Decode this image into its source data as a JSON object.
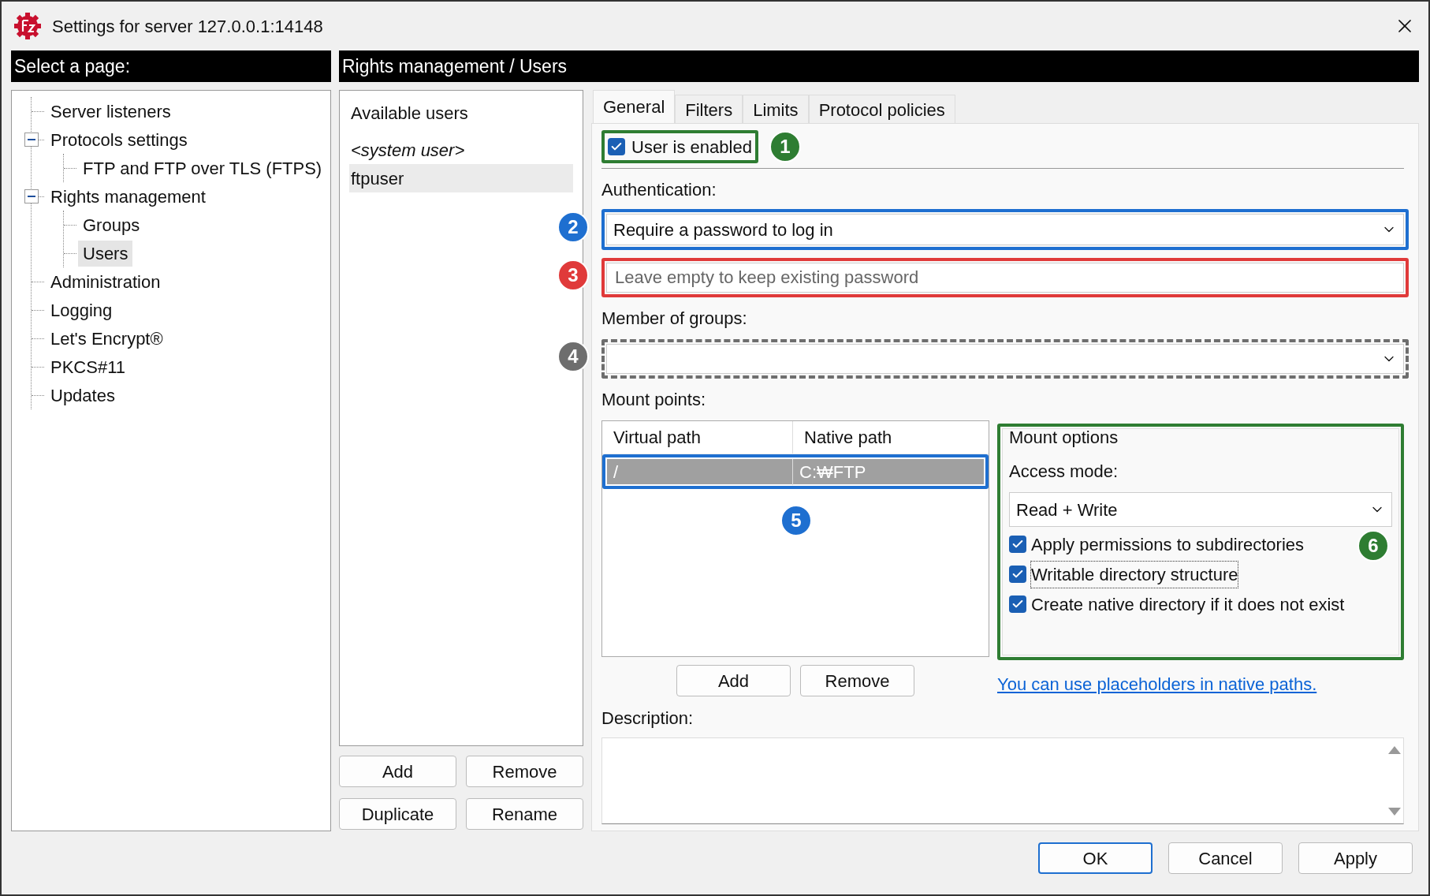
{
  "window": {
    "title": "Settings for server 127.0.0.1:14148"
  },
  "page_selector": {
    "heading": "Select a page:",
    "tree": [
      {
        "label": "Server listeners",
        "selected": false
      },
      {
        "label": "Protocols settings",
        "selected": false,
        "expanded": true,
        "children": [
          {
            "label": "FTP and FTP over TLS (FTPS)",
            "selected": false
          }
        ]
      },
      {
        "label": "Rights management",
        "selected": false,
        "expanded": true,
        "children": [
          {
            "label": "Groups",
            "selected": false
          },
          {
            "label": "Users",
            "selected": true
          }
        ]
      },
      {
        "label": "Administration",
        "selected": false
      },
      {
        "label": "Logging",
        "selected": false
      },
      {
        "label": "Let's Encrypt®",
        "selected": false
      },
      {
        "label": "PKCS#11",
        "selected": false
      },
      {
        "label": "Updates",
        "selected": false
      }
    ]
  },
  "content_header": "Rights management / Users",
  "users": {
    "heading": "Available users",
    "items": [
      {
        "label": "<system user>",
        "kind": "system",
        "selected": false
      },
      {
        "label": "ftpuser",
        "kind": "user",
        "selected": true
      }
    ],
    "buttons": [
      "Add",
      "Remove",
      "Duplicate",
      "Rename"
    ]
  },
  "tabs": [
    {
      "label": "General",
      "selected": true
    },
    {
      "label": "Filters",
      "selected": false
    },
    {
      "label": "Limits",
      "selected": false
    },
    {
      "label": "Protocol policies",
      "selected": false
    }
  ],
  "general": {
    "user_enabled": {
      "label": "User is enabled",
      "checked": true,
      "callout": {
        "number": "1",
        "color": "#2e7d32",
        "dashed": false
      }
    },
    "authentication": {
      "label": "Authentication:",
      "value": "Require a password to log in",
      "callout": {
        "number": "2",
        "color": "#1e6fd0",
        "dashed": false
      }
    },
    "password": {
      "placeholder": "Leave empty to keep existing password",
      "callout": {
        "number": "3",
        "color": "#e03a3a",
        "dashed": false
      }
    },
    "groups": {
      "label": "Member of groups:",
      "callout": {
        "number": "4",
        "color": "#6e6e6e",
        "dashed": true
      }
    },
    "mount_points": {
      "label": "Mount points:",
      "columns": [
        "Virtual path",
        "Native path"
      ],
      "rows": [
        {
          "cells": [
            "/",
            "C:₩FTP"
          ],
          "selected": true
        }
      ],
      "callout": {
        "number": "5",
        "color": "#1e6fd0",
        "dashed": false
      },
      "buttons": [
        "Add",
        "Remove"
      ]
    },
    "mount_options": {
      "title": "Mount options",
      "access_label": "Access mode:",
      "access_value": "Read + Write",
      "options": [
        {
          "label": "Apply permissions to subdirectories",
          "checked": true,
          "focused": false
        },
        {
          "label": "Writable directory structure",
          "checked": true,
          "focused": true
        },
        {
          "label": "Create native directory if it does not exist",
          "checked": true,
          "focused": false
        }
      ],
      "callout": {
        "number": "6",
        "color": "#2e7d32",
        "dashed": false
      },
      "hint_link": "You can use placeholders in native paths."
    },
    "description": {
      "label": "Description:"
    }
  },
  "buttons": [
    {
      "label": "OK",
      "default": true
    },
    {
      "label": "Cancel",
      "default": false
    },
    {
      "label": "Apply",
      "default": false
    }
  ]
}
